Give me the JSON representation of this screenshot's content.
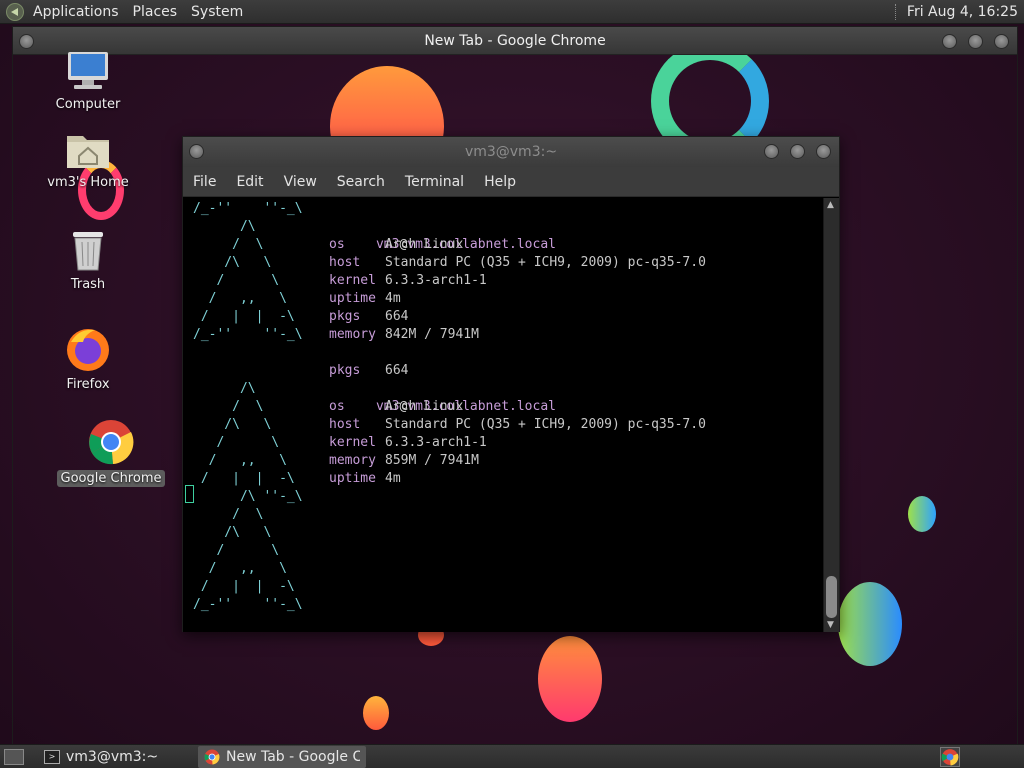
{
  "top_panel": {
    "menus": [
      "Applications",
      "Places",
      "System"
    ],
    "clock": "Fri Aug  4, 16:25"
  },
  "chrome_window": {
    "title": "New Tab - Google Chrome"
  },
  "desktop_icons": [
    {
      "label": "Computer",
      "icon": "computer-icon"
    },
    {
      "label": "vm3's Home",
      "icon": "home-folder-icon"
    },
    {
      "label": "Trash",
      "icon": "trash-icon"
    },
    {
      "label": "Firefox",
      "icon": "firefox-icon"
    },
    {
      "label": "Google Chrome",
      "icon": "chrome-icon",
      "selected": true
    }
  ],
  "terminal": {
    "title": "vm3@vm3:~",
    "menu": [
      "File",
      "Edit",
      "View",
      "Search",
      "Terminal",
      "Help"
    ],
    "art_top": [
      "/_-''    ''-_\\",
      "      /\\",
      "     /  \\",
      "    /\\   \\",
      "   /      \\",
      "  /   ,,   \\",
      " /   |  |  -\\",
      "/_-''    ''-_\\"
    ],
    "art_bottom": [
      "      /\\",
      "     /  \\",
      "    /\\   \\",
      "   /      \\",
      "  /   ,,   \\",
      " /   |  |  -\\",
      "      /\\ ''-_\\",
      "     /  \\",
      "    /\\   \\",
      "   /      \\",
      "  /   ,,   \\",
      " /   |  |  -\\",
      "/_-''    ''-_\\"
    ],
    "block1": {
      "user": "vm3",
      "at": "@",
      "host": "vm3.collabnet.local",
      "rows": [
        {
          "key": "os",
          "value": "Arch Linux"
        },
        {
          "key": "host",
          "value": "Standard PC (Q35 + ICH9, 2009) pc-q35-7.0"
        },
        {
          "key": "kernel",
          "value": "6.3.3-arch1-1"
        },
        {
          "key": "uptime",
          "value": "4m"
        },
        {
          "key": "pkgs",
          "value": "664"
        },
        {
          "key": "memory",
          "value": "842M / 7941M"
        }
      ]
    },
    "block2": {
      "pre": {
        "key": "pkgs",
        "value": "664"
      },
      "user": "vm3",
      "at": "@",
      "host": "vm3.collabnet.local",
      "rows": [
        {
          "key": "os",
          "value": "Arch Linux"
        },
        {
          "key": "host",
          "value": "Standard PC (Q35 + ICH9, 2009) pc-q35-7.0"
        },
        {
          "key": "kernel",
          "value": "6.3.3-arch1-1"
        },
        {
          "key": "memory",
          "value": "859M / 7941M"
        },
        {
          "key": "uptime",
          "value": "4m"
        }
      ]
    }
  },
  "taskbar": {
    "tasks": [
      {
        "label": "vm3@vm3:~",
        "icon": "terminal-icon",
        "active": false
      },
      {
        "label": "New Tab - Google C...",
        "icon": "chrome-icon",
        "active": true
      }
    ]
  },
  "colors": {
    "panel": "#333333",
    "terminal_art": "#7fd1d6",
    "terminal_key": "#c79dd8",
    "cursor": "#3ecf9f"
  }
}
